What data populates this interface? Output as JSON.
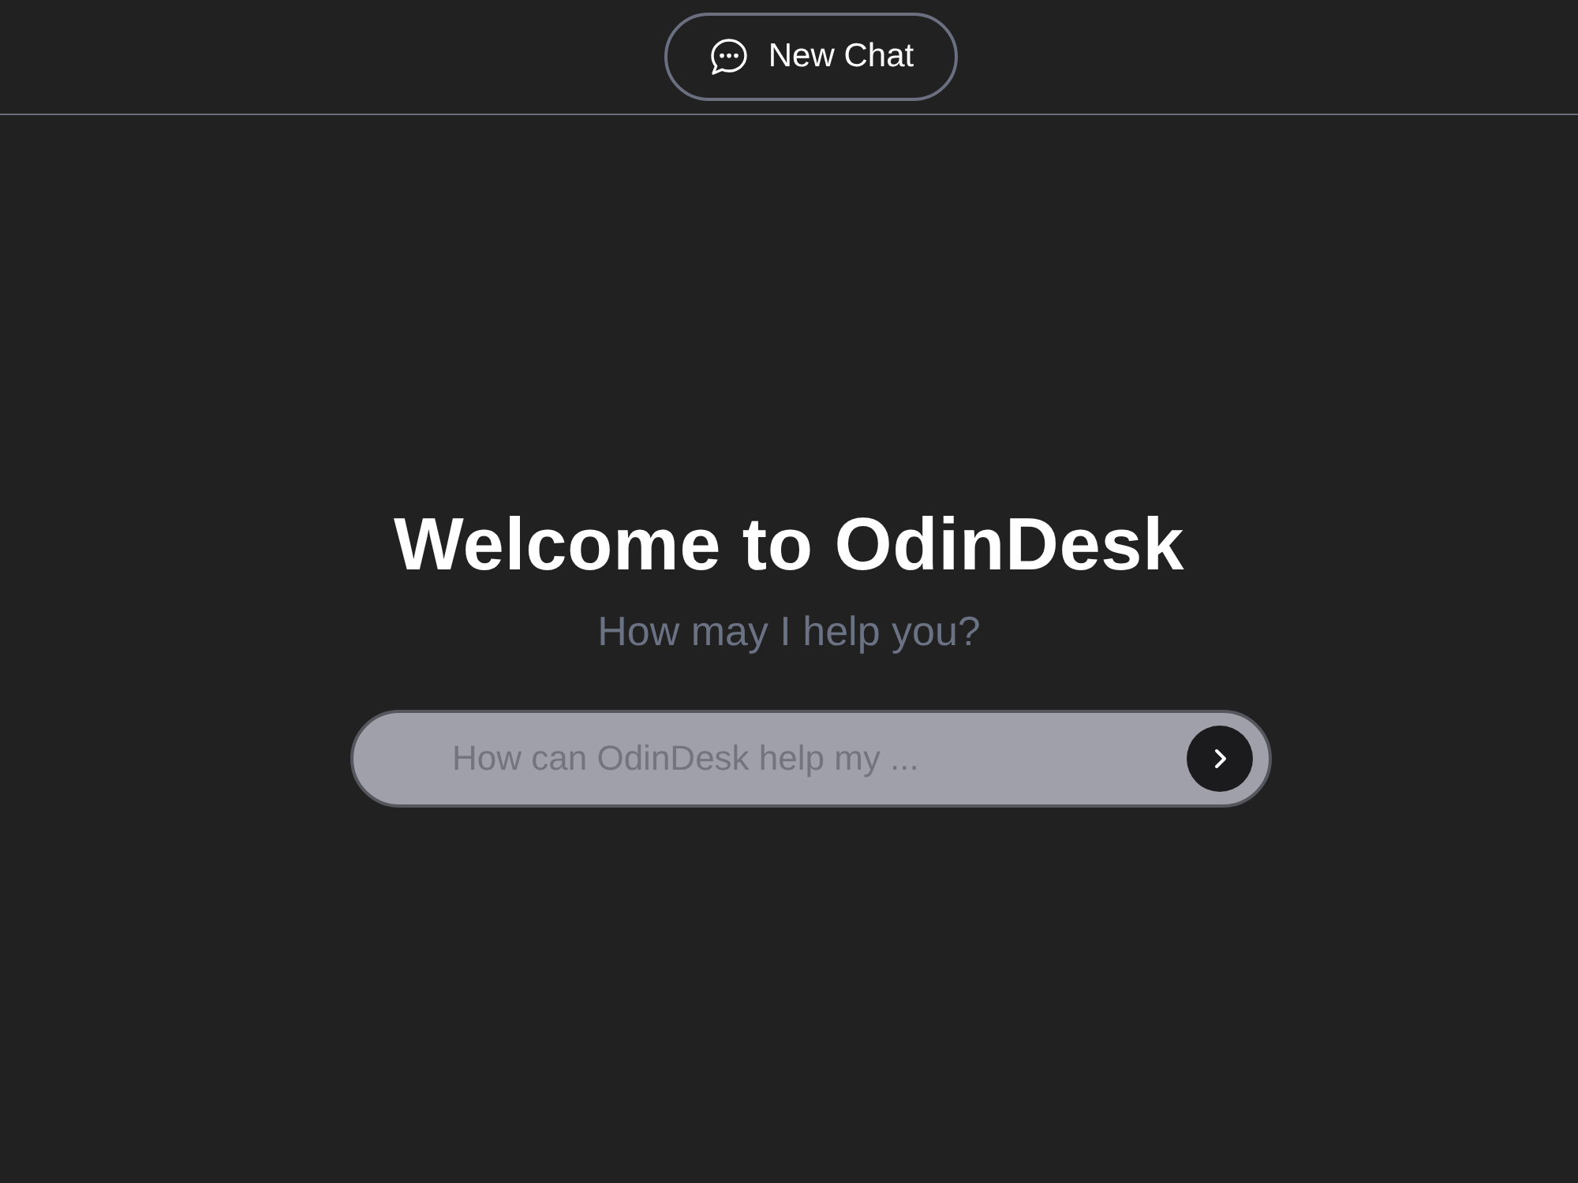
{
  "header": {
    "new_chat_button": {
      "label": "New Chat"
    }
  },
  "welcome": {
    "title": "Welcome to OdinDesk",
    "subtitle": "How may I help you?"
  },
  "chat_input": {
    "placeholder": "How can OdinDesk help my ..."
  }
}
